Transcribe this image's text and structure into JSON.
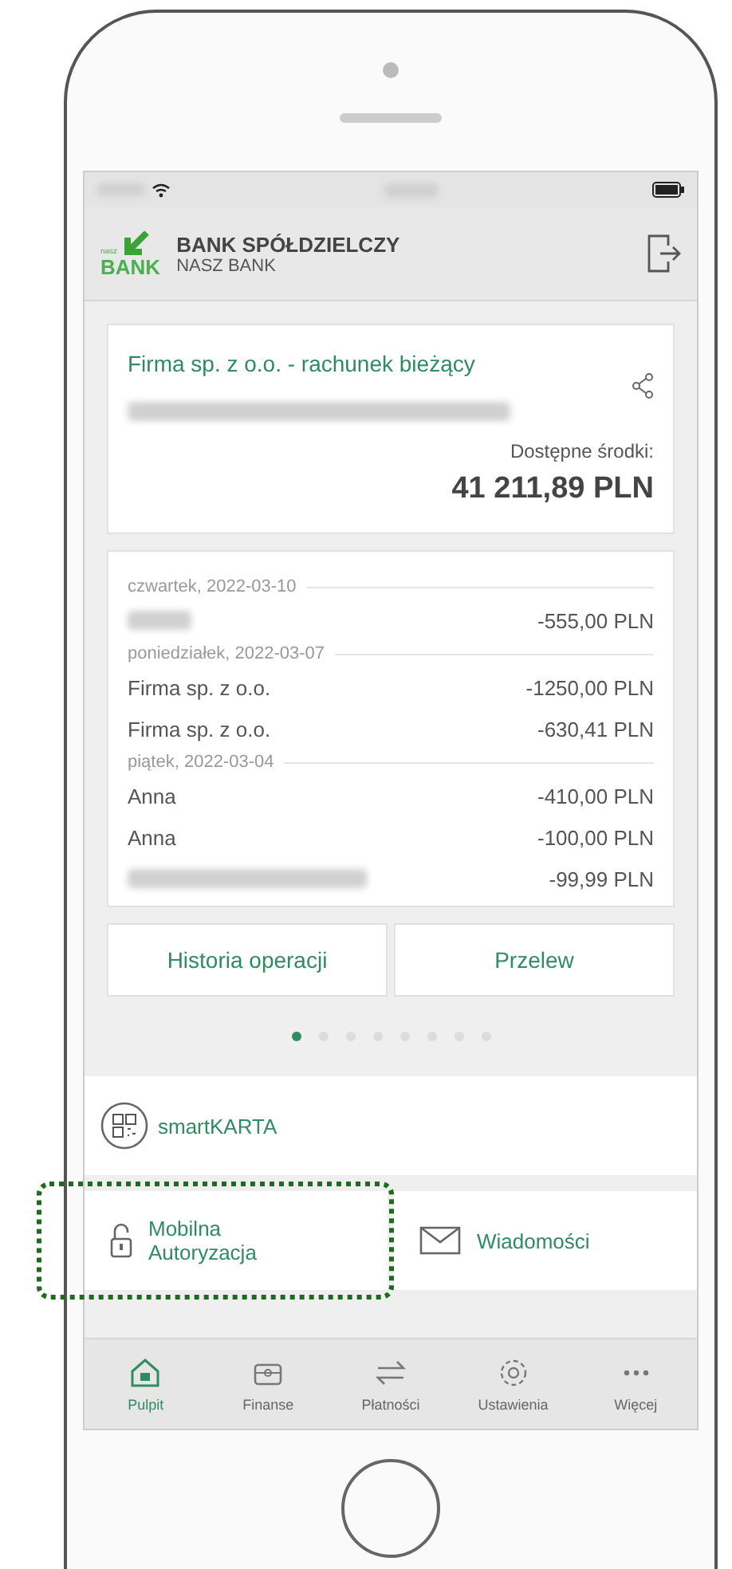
{
  "header": {
    "logo": {
      "small": "nasz",
      "big": "BANK"
    },
    "title": "BANK SPÓŁDZIELCZY",
    "subtitle": "NASZ BANK"
  },
  "account": {
    "name": "Firma sp. z o.o. - rachunek bieżący",
    "balance_label": "Dostępne środki:",
    "balance": "41 211,89 PLN"
  },
  "transactions": [
    {
      "date": "czwartek, 2022-03-10",
      "rows": [
        {
          "amount": "-555,00 PLN"
        }
      ]
    },
    {
      "date": "poniedziałek, 2022-03-07",
      "rows": [
        {
          "name": "Firma sp. z o.o.",
          "amount": "-1250,00 PLN"
        },
        {
          "name": "Firma sp. z o.o.",
          "amount": "-630,41 PLN"
        }
      ]
    },
    {
      "date": "piątek, 2022-03-04",
      "rows": [
        {
          "name": "Anna",
          "amount": "-410,00 PLN"
        },
        {
          "name": "Anna",
          "amount": "-100,00 PLN"
        },
        {
          "amount": "-99,99 PLN"
        }
      ]
    }
  ],
  "actions": [
    "Historia operacji",
    "Przelew"
  ],
  "pager": [
    {
      "selected": true
    },
    {
      "selected": false
    },
    {
      "selected": false
    },
    {
      "selected": false
    },
    {
      "selected": false
    },
    {
      "selected": false
    },
    {
      "selected": false
    },
    {
      "selected": false
    }
  ],
  "smartkarta": {
    "label": "smartKARTA"
  },
  "tiles": [
    {
      "kind": "lock",
      "label": "Mobilna Autoryzacja",
      "highlighted": true
    },
    {
      "kind": "mail",
      "label": "Wiadomości",
      "highlighted": false
    }
  ],
  "nav": [
    {
      "kind": "home",
      "label": "Pulpit",
      "selected": true
    },
    {
      "kind": "wallet",
      "label": "Finanse",
      "selected": false
    },
    {
      "kind": "transfer",
      "label": "Płatności",
      "selected": false
    },
    {
      "kind": "gear",
      "label": "Ustawienia",
      "selected": false
    },
    {
      "kind": "more",
      "label": "Więcej",
      "selected": false
    }
  ]
}
